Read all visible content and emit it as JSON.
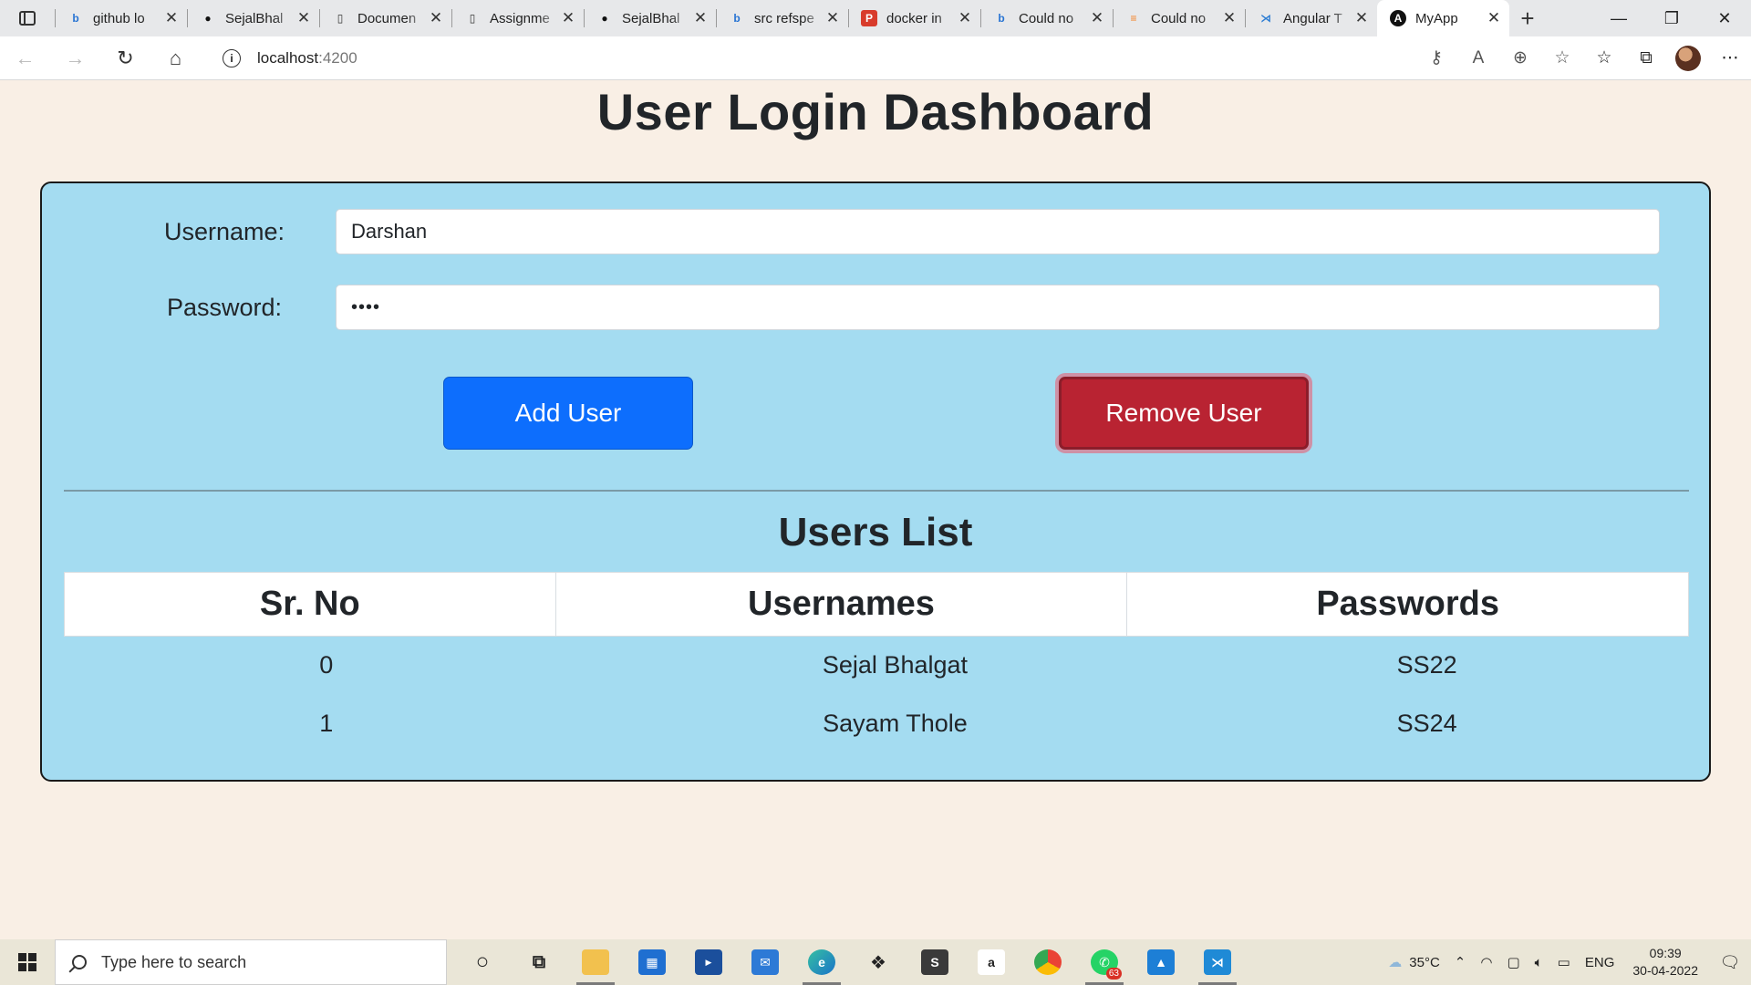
{
  "browser": {
    "tabs": [
      {
        "title": "github lo",
        "icon": "bing-icon",
        "color": "#2874d3"
      },
      {
        "title": "SejalBhal",
        "icon": "github-icon",
        "color": "#111111"
      },
      {
        "title": "Documen",
        "icon": "document-icon",
        "color": "#333333"
      },
      {
        "title": "Assignme",
        "icon": "document-icon",
        "color": "#333333"
      },
      {
        "title": "SejalBhal",
        "icon": "github-icon",
        "color": "#111111"
      },
      {
        "title": "src refspe",
        "icon": "bing-icon",
        "color": "#2874d3"
      },
      {
        "title": "docker in",
        "icon": "pdf-icon",
        "color": "#d83b2b"
      },
      {
        "title": "Could no",
        "icon": "bing-icon",
        "color": "#2874d3"
      },
      {
        "title": "Could no",
        "icon": "stackoverflow-icon",
        "color": "#f48024"
      },
      {
        "title": "Angular T",
        "icon": "vscode-icon",
        "color": "#2b7cd3"
      },
      {
        "title": "MyApp",
        "icon": "angular-icon",
        "color": "#111111",
        "active": true
      }
    ],
    "address": {
      "host": "localhost",
      "port": ":4200"
    }
  },
  "page": {
    "title": "User Login Dashboard",
    "form": {
      "username_label": "Username:",
      "username_value": "Darshan",
      "password_label": "Password:",
      "password_value": "••••"
    },
    "buttons": {
      "add_label": "Add User",
      "remove_label": "Remove User"
    },
    "list_title": "Users List",
    "table": {
      "headers": [
        "Sr. No",
        "Usernames",
        "Passwords"
      ],
      "rows": [
        [
          "0",
          "Sejal Bhalgat",
          "SS22"
        ],
        [
          "1",
          "Sayam Thole",
          "SS24"
        ]
      ]
    },
    "colors": {
      "background": "#f9efe5",
      "card": "#a4dcf1",
      "add_button": "#0d6efd",
      "remove_button": "#b92332"
    }
  },
  "taskbar": {
    "search_placeholder": "Type here to search",
    "apps": [
      "cortana-icon",
      "task-view-icon",
      "file-explorer-icon",
      "store-icon",
      "prime-video-icon",
      "mail-icon",
      "edge-icon",
      "dropbox-icon",
      "sublime-icon",
      "amazon-icon",
      "chrome-icon",
      "whatsapp-icon",
      "photos-icon",
      "vscode-icon"
    ],
    "whatsapp_badge": "63",
    "weather": "35°C",
    "language": "ENG",
    "time": "09:39",
    "date": "30-04-2022"
  }
}
